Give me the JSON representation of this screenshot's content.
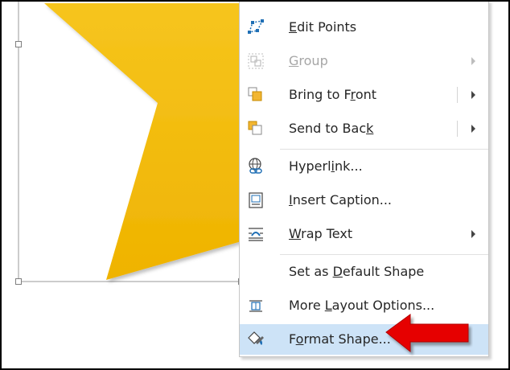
{
  "colors": {
    "shape_fill_top": "#f5c21a",
    "shape_fill_bottom": "#f0b400",
    "menu_highlight": "#cde3f7",
    "arrow_red": "#e60000"
  },
  "menu": {
    "items": [
      {
        "label_pre": "",
        "label_u": "E",
        "label_post": "dit Points",
        "icon": "edit-points-icon",
        "disabled": false,
        "submenu": false,
        "split": false
      },
      {
        "label_pre": "",
        "label_u": "G",
        "label_post": "roup",
        "icon": "group-icon",
        "disabled": true,
        "submenu": true,
        "split": false
      },
      {
        "label_pre": "Bring to F",
        "label_u": "r",
        "label_post": "ont",
        "icon": "bring-to-front-icon",
        "disabled": false,
        "submenu": true,
        "split": true
      },
      {
        "label_pre": "Send to Bac",
        "label_u": "k",
        "label_post": "",
        "icon": "send-to-back-icon",
        "disabled": false,
        "submenu": true,
        "split": true
      },
      {
        "label_pre": "Hyperl",
        "label_u": "i",
        "label_post": "nk...",
        "icon": "hyperlink-icon",
        "disabled": false,
        "submenu": false,
        "split": false
      },
      {
        "label_pre": "",
        "label_u": "I",
        "label_post": "nsert Caption...",
        "icon": "insert-caption-icon",
        "disabled": false,
        "submenu": false,
        "split": false
      },
      {
        "label_pre": "",
        "label_u": "W",
        "label_post": "rap Text",
        "icon": "wrap-text-icon",
        "disabled": false,
        "submenu": true,
        "split": false
      },
      {
        "label_pre": "Set as ",
        "label_u": "D",
        "label_post": "efault Shape",
        "icon": "",
        "disabled": false,
        "submenu": false,
        "split": false
      },
      {
        "label_pre": "More ",
        "label_u": "L",
        "label_post": "ayout Options...",
        "icon": "layout-options-icon",
        "disabled": false,
        "submenu": false,
        "split": false
      },
      {
        "label_pre": "F",
        "label_u": "o",
        "label_post": "rmat Shape...",
        "icon": "format-shape-icon",
        "disabled": false,
        "submenu": false,
        "split": false,
        "highlighted": true
      }
    ]
  }
}
